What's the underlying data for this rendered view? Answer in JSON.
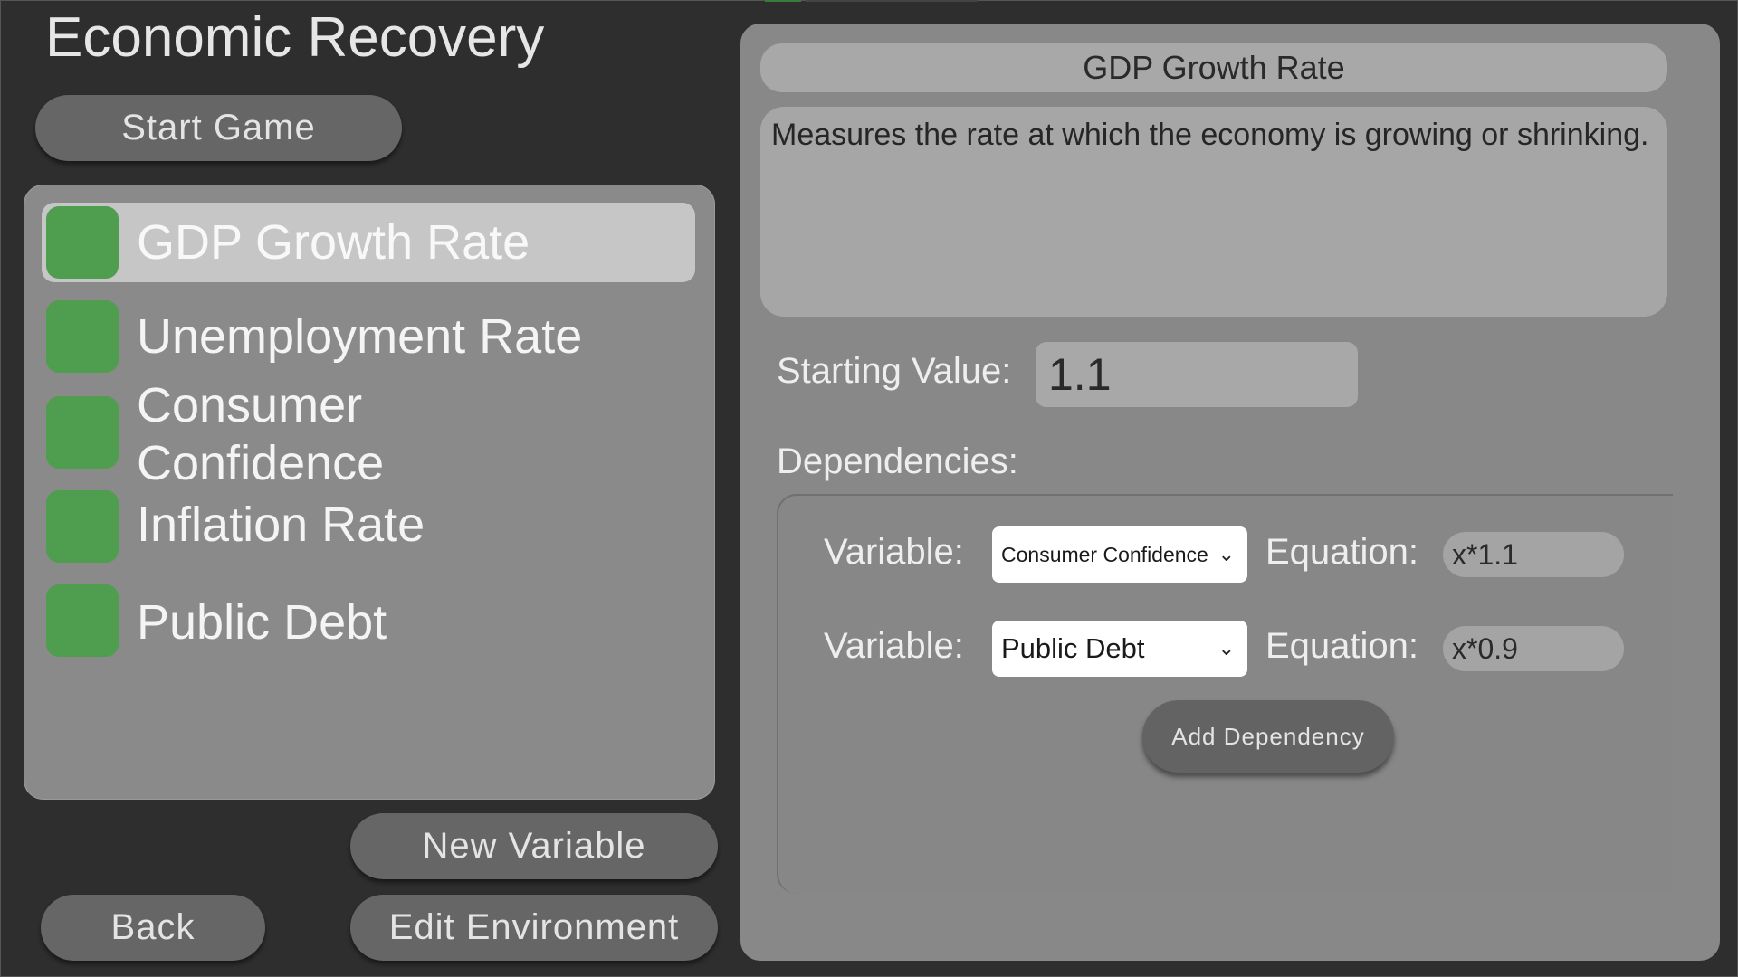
{
  "app": {
    "title": "Economic Recovery"
  },
  "buttons": {
    "start_game": "Start Game",
    "new_variable": "New Variable",
    "back": "Back",
    "edit_environment": "Edit Environment"
  },
  "variables": [
    {
      "label": "GDP Growth Rate",
      "color": "#4f9d4f",
      "selected": true
    },
    {
      "label": "Unemployment Rate",
      "color": "#4f9d4f",
      "selected": false
    },
    {
      "label": "Consumer Confidence",
      "color": "#4f9d4f",
      "selected": false
    },
    {
      "label": "Inflation Rate",
      "color": "#4f9d4f",
      "selected": false
    },
    {
      "label": "Public Debt",
      "color": "#4f9d4f",
      "selected": false
    }
  ],
  "detail": {
    "title": "GDP Growth Rate",
    "description": "Measures the rate at which the economy is growing or shrinking.",
    "starting_value_label": "Starting Value:",
    "starting_value": "1.1",
    "dependencies_label": "Dependencies:",
    "dependencies": [
      {
        "variable_label": "Variable:",
        "variable": "Consumer Confidence",
        "equation_label": "Equation:",
        "equation": "x*1.1"
      },
      {
        "variable_label": "Variable:",
        "variable": "Public Debt",
        "equation_label": "Equation:",
        "equation": "x*0.9"
      }
    ],
    "add_dependency": "Add Dependency"
  },
  "icons": {
    "dropdown": "chevron-down-icon",
    "swatch": "color-swatch"
  }
}
